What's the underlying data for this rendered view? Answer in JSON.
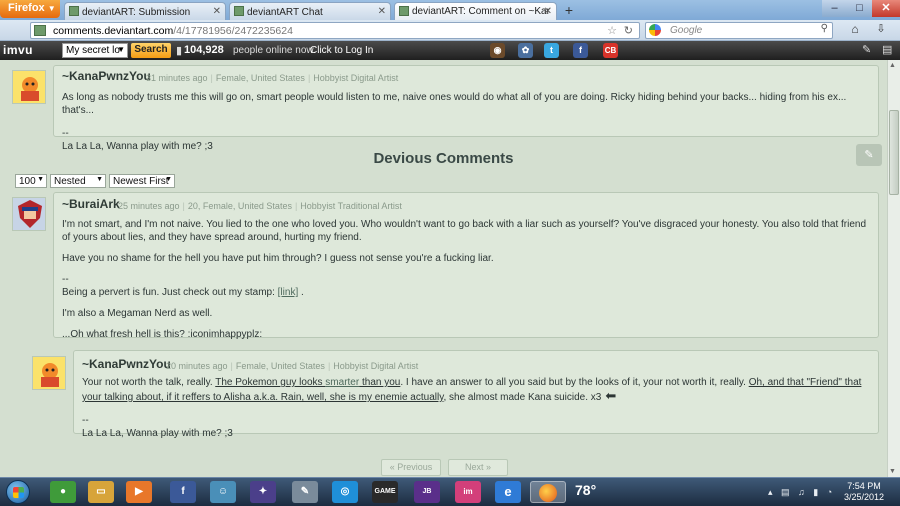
{
  "browser": {
    "menu_label": "Firefox",
    "tabs": [
      {
        "label": "deviantART: Submission"
      },
      {
        "label": "deviantART Chat"
      },
      {
        "label": "deviantART: Comment on ~KanaPwn..."
      }
    ],
    "url_domain": "comments.deviantart.com",
    "url_path": "/4/17781956/2472235624",
    "search_placeholder": "Google"
  },
  "imvu": {
    "logo": "imvu",
    "select_value": "My secret lo",
    "search_label": "Search",
    "online_count": "104,928",
    "online_label": "people online now.",
    "login_label": "Click to Log In"
  },
  "comments": {
    "top": {
      "author": "~KanaPwnzYou",
      "time": "31 minutes ago",
      "demographic": "Female, United States",
      "title": "Hobbyist Digital Artist",
      "body": "As long as nobody trusts me this will go on, smart people would listen to me, naive ones would do what all of you are doing. Ricky hiding behind your backs... hiding from his ex... that's...",
      "sig_dash": "--",
      "signature": "La La La, Wanna play with me? ;3"
    },
    "section_title": "Devious Comments",
    "controls": {
      "per_page": "100",
      "view": "Nested",
      "sort": "Newest First"
    },
    "main": {
      "author": "~BuraiArk",
      "time": "25 minutes ago",
      "demographic": "20, Female, United States",
      "title": "Hobbyist Traditional Artist",
      "p1": "I'm not smart, and I'm not naive. You lied to the one who loved you. Who wouldn't want to go back with a liar such as yourself? You've disgraced your honesty. You also told that friend of yours about lies, and they have spread around, hurting my friend.",
      "p2": "Have you no shame for the hell you have put him through? I guess not sense you're a fucking liar.",
      "sig_dash": "--",
      "sig1_before": "Being a pervert is fun. Just check out my stamp: ",
      "sig1_link": "[link]",
      "sig1_after": " .",
      "sig2": "I'm also a Megaman Nerd as well.",
      "sig3": "...Oh what fresh hell is this? :iconimhappyplz:"
    },
    "reply": {
      "author": "~KanaPwnzYou",
      "time": "20 minutes ago",
      "demographic": "Female, United States",
      "title": "Hobbyist Digital Artist",
      "t1": "Your not worth the talk, really. ",
      "t2": "The Pokemon guy looks ",
      "t3": "smarter",
      "t4": " than you",
      "t5": ". I have an answer to all you said but by the looks of it, your not worth it, really. ",
      "t6": "Oh, and that \"Friend\" that your talking about, if it reffers to Alisha a.k.a. Rain, well, she is my enemie actually",
      "t7": ", she almost made Kana suicide. x3",
      "sig_dash": "--",
      "signature": "La La La, Wanna play with me? ;3"
    },
    "pager": {
      "previous": "« Previous",
      "next": "Next »"
    }
  },
  "taskbar": {
    "weather": "78°",
    "time": "7:54 PM",
    "date": "3/25/2012"
  }
}
